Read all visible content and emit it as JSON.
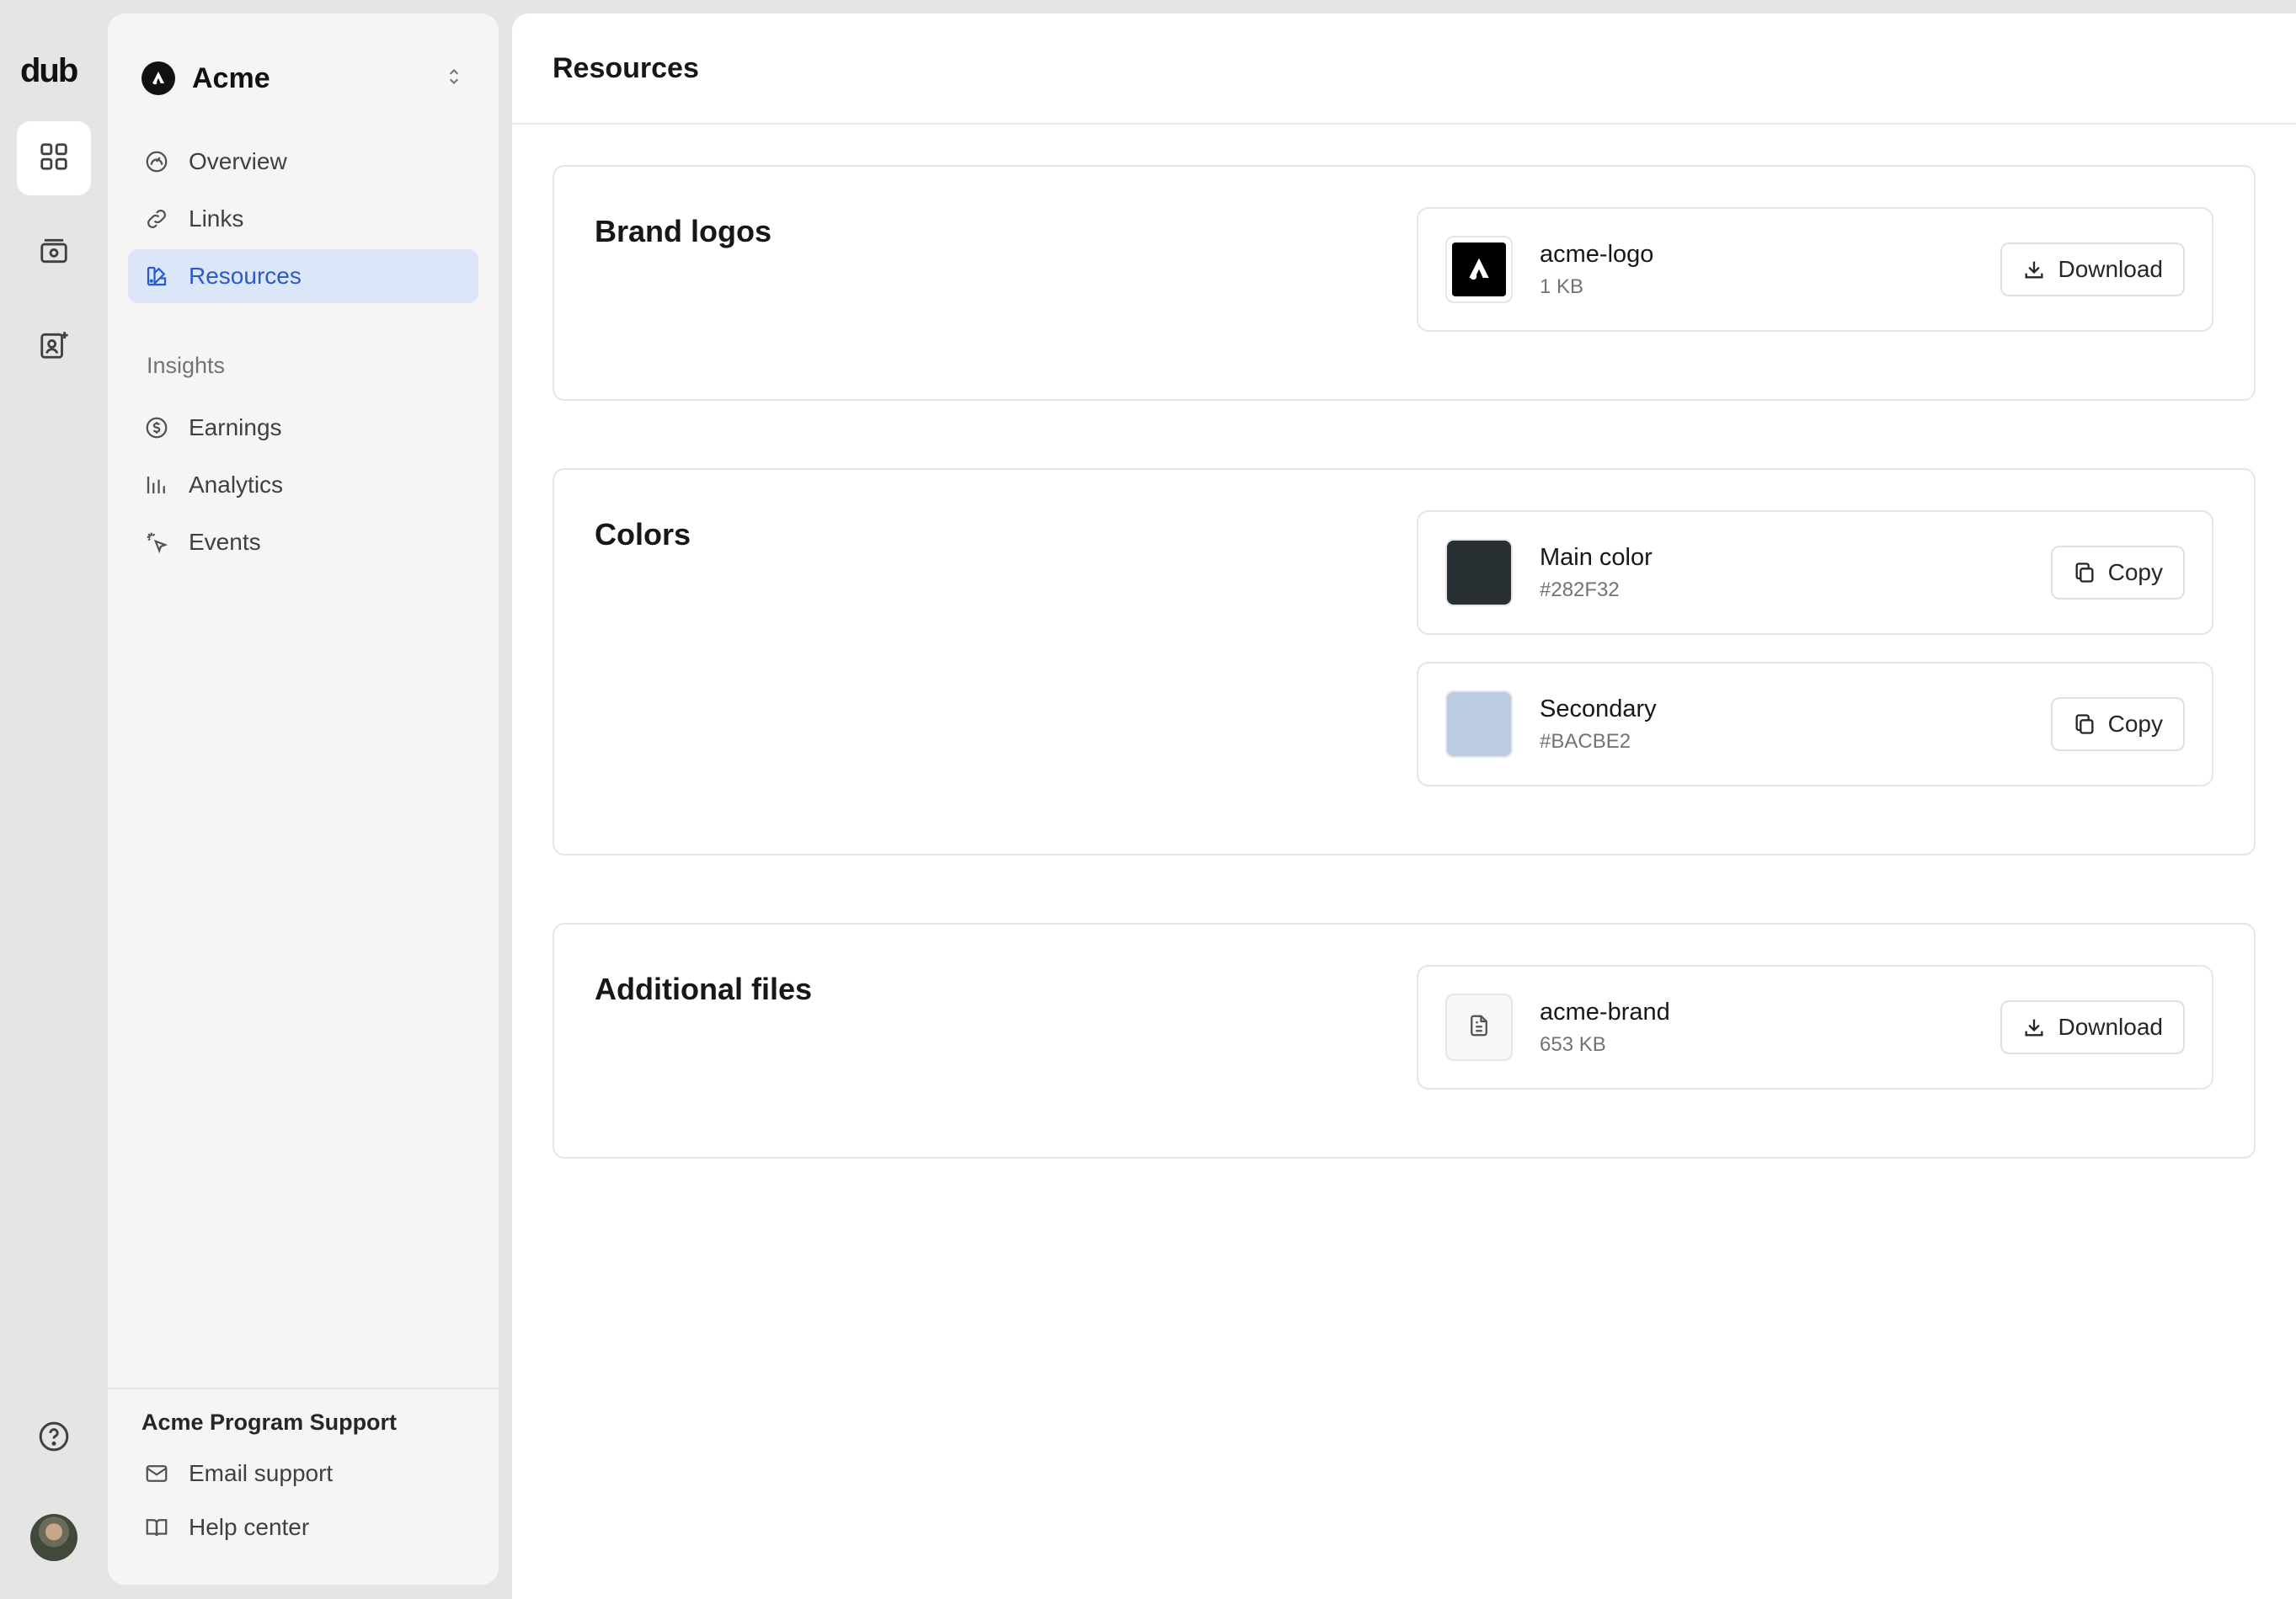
{
  "rail": {
    "logo": "dub",
    "items": [
      {
        "icon": "grid-icon",
        "active": true
      },
      {
        "icon": "money-icon",
        "active": false
      },
      {
        "icon": "user-plus-icon",
        "active": false
      }
    ],
    "help_icon": "help-circle-icon",
    "avatar_icon": "user-avatar"
  },
  "sidebar": {
    "workspace_name": "Acme",
    "nav": [
      {
        "label": "Overview",
        "icon": "gauge-icon"
      },
      {
        "label": "Links",
        "icon": "link-icon"
      },
      {
        "label": "Resources",
        "icon": "palette-icon",
        "active": true
      }
    ],
    "insights_title": "Insights",
    "insights": [
      {
        "label": "Earnings",
        "icon": "dollar-circle-icon"
      },
      {
        "label": "Analytics",
        "icon": "bar-chart-icon"
      },
      {
        "label": "Events",
        "icon": "cursor-rays-icon"
      }
    ],
    "support": {
      "title": "Acme Program Support",
      "items": [
        {
          "label": "Email support",
          "icon": "mail-icon"
        },
        {
          "label": "Help center",
          "icon": "book-icon"
        }
      ]
    }
  },
  "main": {
    "title": "Resources",
    "sections": {
      "brand_logos": {
        "title": "Brand logos",
        "items": [
          {
            "name": "acme-logo",
            "size": "1 KB",
            "action": "Download"
          }
        ]
      },
      "colors": {
        "title": "Colors",
        "items": [
          {
            "name": "Main color",
            "hex": "#282F32",
            "swatch": "#282F32",
            "action": "Copy"
          },
          {
            "name": "Secondary",
            "hex": "#BACBE2",
            "swatch": "#BACBE2",
            "action": "Copy"
          }
        ]
      },
      "additional_files": {
        "title": "Additional files",
        "items": [
          {
            "name": "acme-brand",
            "size": "653 KB",
            "action": "Download"
          }
        ]
      }
    }
  },
  "colors": {
    "accent": "#2b5bc9",
    "active_nav_bg": "#dbe6f8"
  }
}
